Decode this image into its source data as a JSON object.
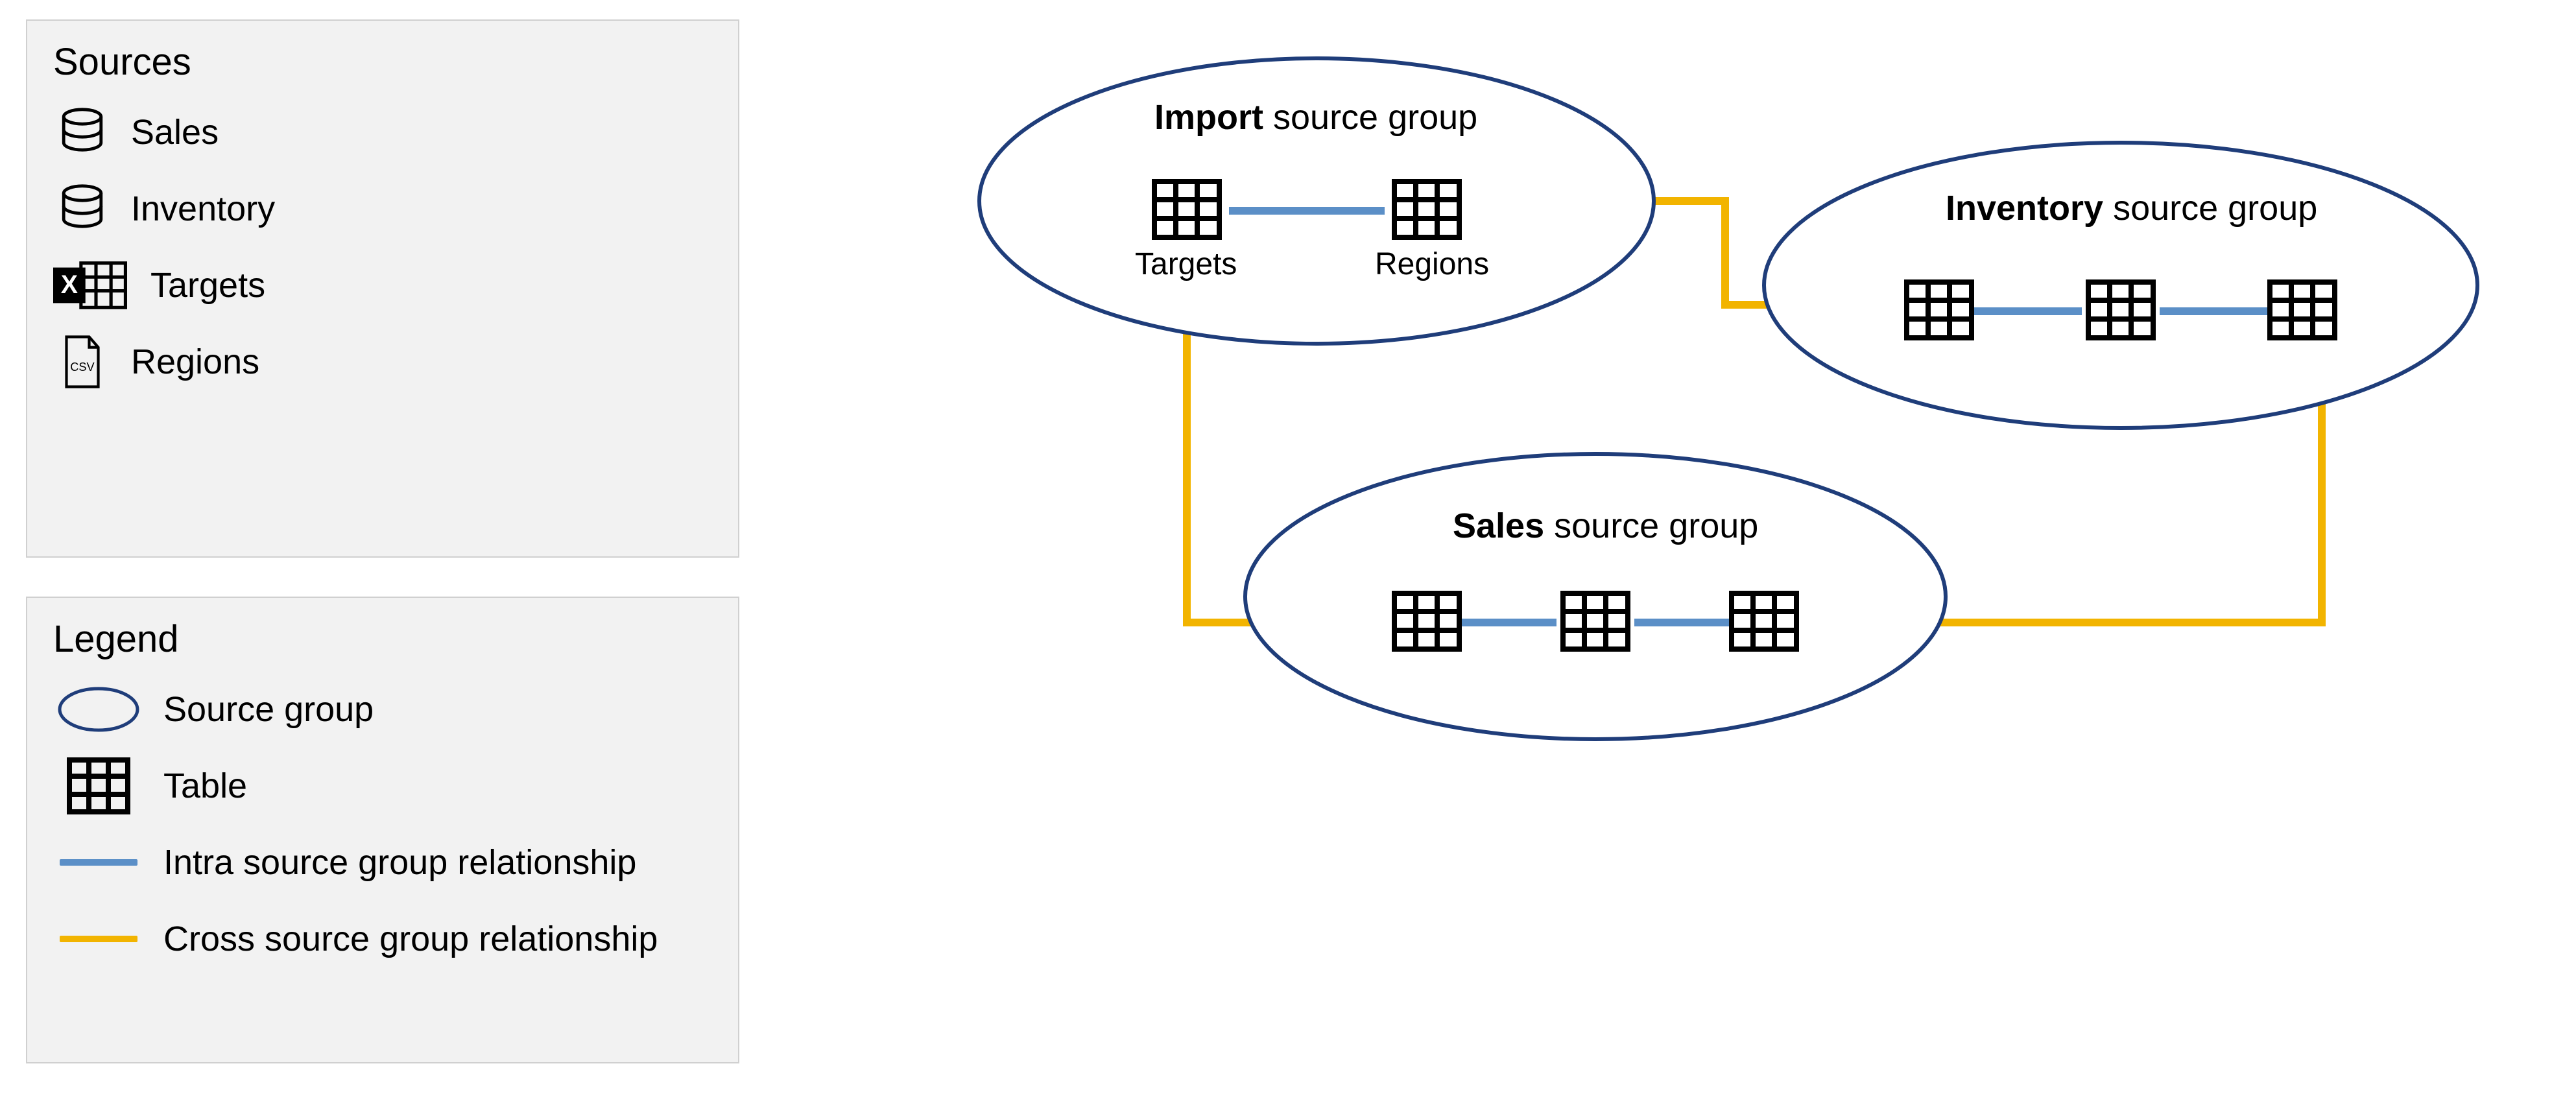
{
  "sources_panel": {
    "title": "Sources",
    "items": [
      {
        "label": "Sales",
        "icon": "database-icon"
      },
      {
        "label": "Inventory",
        "icon": "database-icon"
      },
      {
        "label": "Targets",
        "icon": "excel-icon"
      },
      {
        "label": "Regions",
        "icon": "csv-file-icon"
      }
    ]
  },
  "legend_panel": {
    "title": "Legend",
    "items": [
      {
        "label": "Source group",
        "symbol": "ellipse"
      },
      {
        "label": "Table",
        "symbol": "table-icon"
      },
      {
        "label": "Intra source group relationship",
        "symbol": "line",
        "color": "#5b8fc7"
      },
      {
        "label": "Cross source group relationship",
        "symbol": "line",
        "color": "#f2b400"
      }
    ]
  },
  "diagram": {
    "groups": {
      "import": {
        "bold": "Import",
        "rest": " source group",
        "tables": [
          "Targets",
          "Regions"
        ]
      },
      "inventory": {
        "bold": "Inventory",
        "rest": " source group",
        "table_count": 3
      },
      "sales": {
        "bold": "Sales",
        "rest": " source group",
        "table_count": 3
      }
    },
    "colors": {
      "ellipse_stroke": "#1f3d7a",
      "intra": "#5b8fc7",
      "cross": "#f2b400"
    }
  }
}
